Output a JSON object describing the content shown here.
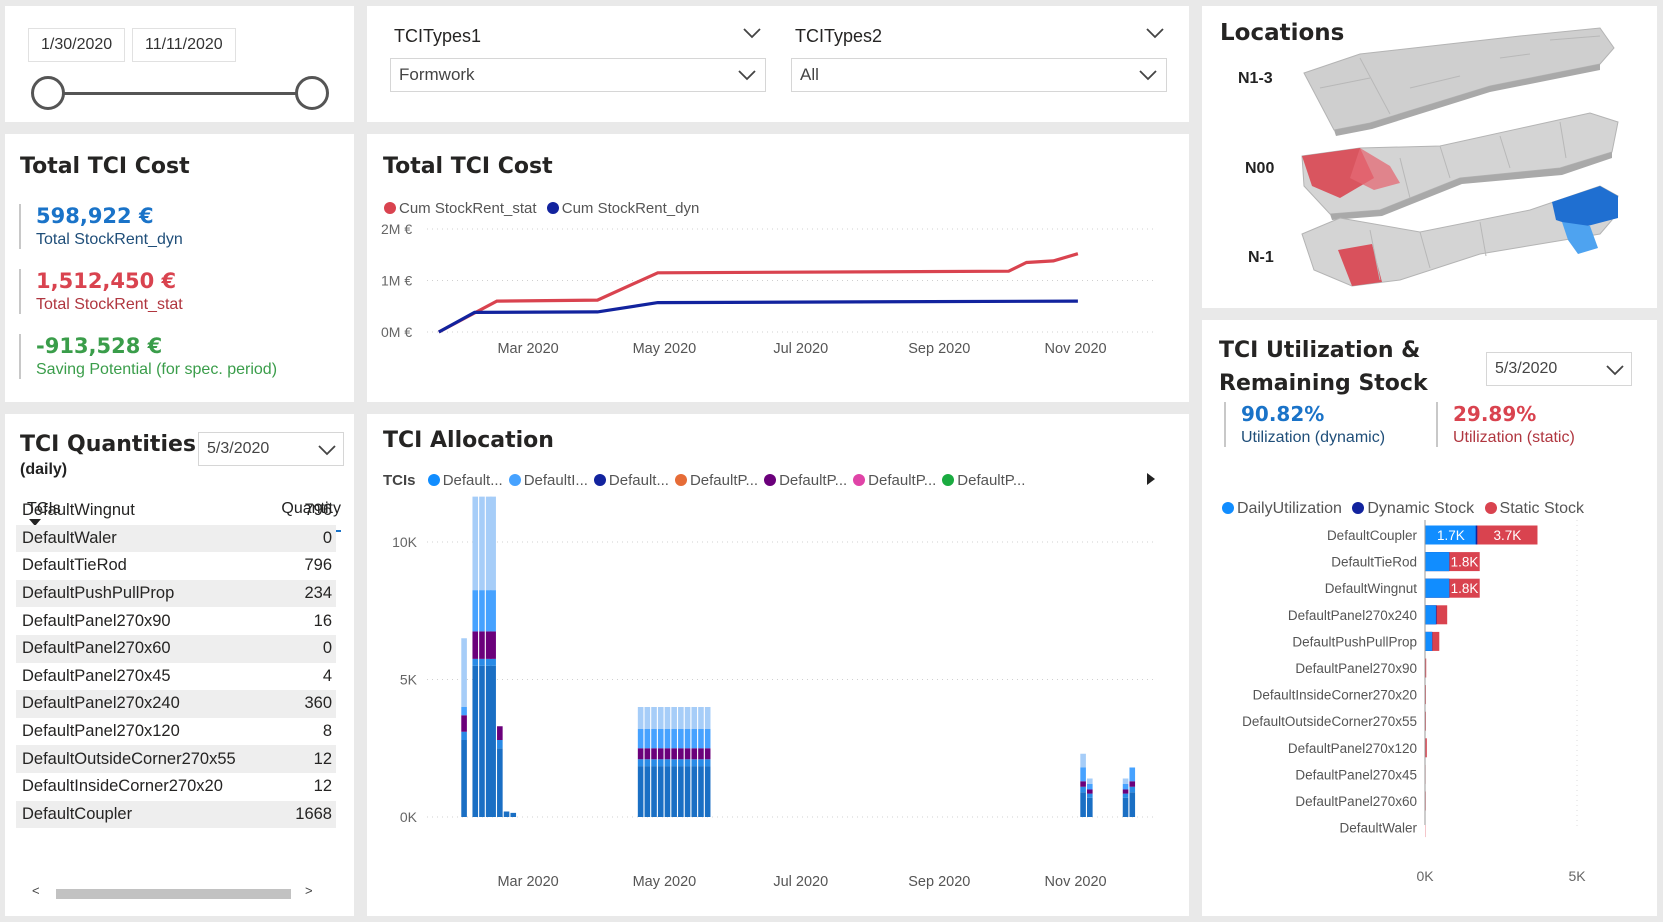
{
  "date_slicer": {
    "start": "1/30/2020",
    "end": "11/11/2020"
  },
  "filters": {
    "tcitypes1": {
      "label": "TCITypes1",
      "value": "Formwork"
    },
    "tcitypes2": {
      "label": "TCITypes2",
      "value": "All"
    }
  },
  "locations": {
    "title": "Locations",
    "levels": [
      "N1-3",
      "N00",
      "N-1"
    ]
  },
  "total_cost_kpi": {
    "title": "Total TCI Cost",
    "dyn_value": "598,922 €",
    "dyn_label": "Total StockRent_dyn",
    "stat_value": "1,512,450 €",
    "stat_label": "Total StockRent_stat",
    "saving_value": "-913,528 €",
    "saving_label": "Saving Potential (for spec. period)"
  },
  "quantities": {
    "title": "TCI Quantities",
    "subtitle": "(daily)",
    "date": "5/3/2020",
    "col_tci": "TCIs",
    "col_qty": "Quantity",
    "rows": [
      [
        "DefaultWingnut",
        "796"
      ],
      [
        "DefaultWaler",
        "0"
      ],
      [
        "DefaultTieRod",
        "796"
      ],
      [
        "DefaultPushPullProp",
        "234"
      ],
      [
        "DefaultPanel270x90",
        "16"
      ],
      [
        "DefaultPanel270x60",
        "0"
      ],
      [
        "DefaultPanel270x45",
        "4"
      ],
      [
        "DefaultPanel270x240",
        "360"
      ],
      [
        "DefaultPanel270x120",
        "8"
      ],
      [
        "DefaultOutsideCorner270x55",
        "12"
      ],
      [
        "DefaultInsideCorner270x20",
        "12"
      ],
      [
        "DefaultCoupler",
        "1668"
      ]
    ],
    "scroll_left": "<",
    "scroll_right": ">"
  },
  "utilization": {
    "title_line1": "TCI Utilization &",
    "title_line2": "Remaining Stock",
    "date": "5/3/2020",
    "dyn_value": "90.82%",
    "dyn_label": "Utilization (dynamic)",
    "stat_value": "29.89%",
    "stat_label": "Utilization (static)"
  },
  "colors": {
    "stat_red": "#d9434f",
    "dyn_navy": "#12239e",
    "dyn_blue": "#1a73c8",
    "saving_green": "#3a9d4a",
    "daily_blue": "#118dff"
  },
  "chart_data": [
    {
      "type": "line",
      "title": "Total TCI Cost",
      "series": [
        {
          "name": "Cum StockRent_stat",
          "color": "#d9434f",
          "points": [
            [
              "2020-01-30",
              0
            ],
            [
              "2020-02-25",
              0.6
            ],
            [
              "2020-04-10",
              0.62
            ],
            [
              "2020-05-07",
              1.15
            ],
            [
              "2020-10-11",
              1.18
            ],
            [
              "2020-10-19",
              1.35
            ],
            [
              "2020-10-31",
              1.38
            ],
            [
              "2020-11-11",
              1.52
            ]
          ]
        },
        {
          "name": "Cum StockRent_dyn",
          "color": "#12239e",
          "points": [
            [
              "2020-01-30",
              0
            ],
            [
              "2020-02-15",
              0.38
            ],
            [
              "2020-04-10",
              0.39
            ],
            [
              "2020-05-07",
              0.57
            ],
            [
              "2020-11-11",
              0.6
            ]
          ]
        }
      ],
      "y_ticks": [
        "2M €",
        "1M €",
        "0M €"
      ],
      "yunit": "M €",
      "ylim": [
        0,
        2
      ],
      "x_ticks": [
        "Mar 2020",
        "May 2020",
        "Jul 2020",
        "Sep 2020",
        "Nov 2020"
      ],
      "grid": true,
      "legend": "top-left"
    },
    {
      "type": "bar",
      "title": "TCI Allocation",
      "legend_title": "TCIs",
      "legend": [
        "Default...",
        "DefaultI...",
        "Default...",
        "DefaultP...",
        "DefaultP...",
        "DefaultP...",
        "DefaultP..."
      ],
      "legend_colors": [
        "#118dff",
        "#46a2ff",
        "#12239e",
        "#e66c37",
        "#6b007b",
        "#e044a7",
        "#1aab40"
      ],
      "y_ticks": [
        "10K",
        "5K",
        "0K"
      ],
      "ylim": [
        0,
        12000
      ],
      "x_ticks": [
        "Mar 2020",
        "May 2020",
        "Jul 2020",
        "Sep 2020",
        "Nov 2020"
      ],
      "grid": true,
      "stack_colors": [
        "#1a6fc4",
        "#2a8be6",
        "#6b007b",
        "#46a2ff",
        "#a6cdf8"
      ],
      "bars": [
        {
          "date": "2020-02-01",
          "stack": [
            2800,
            300,
            600,
            300,
            2500
          ]
        },
        {
          "date": "2020-02-06",
          "stack": [
            5500,
            250,
            1000,
            1500,
            3400
          ]
        },
        {
          "date": "2020-02-09",
          "stack": [
            5500,
            250,
            1000,
            1500,
            3400
          ]
        },
        {
          "date": "2020-02-12",
          "stack": [
            5500,
            250,
            1000,
            1500,
            3400
          ]
        },
        {
          "date": "2020-02-14",
          "stack": [
            5500,
            250,
            1000,
            1500,
            3400
          ]
        },
        {
          "date": "2020-02-17",
          "stack": [
            2500,
            300,
            500,
            0,
            0
          ]
        },
        {
          "date": "2020-02-20",
          "stack": [
            200,
            0,
            0,
            0,
            0
          ]
        },
        {
          "date": "2020-02-23",
          "stack": [
            150,
            0,
            0,
            0,
            0
          ]
        },
        {
          "date": "2020-04-20",
          "stack": [
            1850,
            250,
            400,
            700,
            800
          ]
        },
        {
          "date": "2020-04-23",
          "stack": [
            1850,
            250,
            400,
            700,
            800
          ]
        },
        {
          "date": "2020-04-26",
          "stack": [
            1850,
            250,
            400,
            700,
            800
          ]
        },
        {
          "date": "2020-04-29",
          "stack": [
            1850,
            250,
            400,
            700,
            800
          ]
        },
        {
          "date": "2020-05-02",
          "stack": [
            1850,
            250,
            400,
            700,
            800
          ]
        },
        {
          "date": "2020-05-05",
          "stack": [
            1850,
            250,
            400,
            700,
            800
          ]
        },
        {
          "date": "2020-05-08",
          "stack": [
            1850,
            250,
            400,
            700,
            800
          ]
        },
        {
          "date": "2020-05-11",
          "stack": [
            1850,
            250,
            400,
            700,
            800
          ]
        },
        {
          "date": "2020-05-14",
          "stack": [
            1850,
            250,
            400,
            700,
            800
          ]
        },
        {
          "date": "2020-05-17",
          "stack": [
            1850,
            250,
            400,
            700,
            800
          ]
        },
        {
          "date": "2020-05-20",
          "stack": [
            1850,
            250,
            400,
            700,
            800
          ]
        },
        {
          "date": "2020-11-04",
          "stack": [
            900,
            200,
            200,
            500,
            500
          ]
        },
        {
          "date": "2020-11-07",
          "stack": [
            700,
            150,
            150,
            200,
            200
          ]
        },
        {
          "date": "2020-11-23",
          "stack": [
            700,
            150,
            150,
            200,
            200
          ]
        },
        {
          "date": "2020-11-26",
          "stack": [
            900,
            200,
            200,
            500,
            0
          ]
        }
      ]
    },
    {
      "type": "bar",
      "orientation": "horizontal",
      "legend": [
        "DailyUtilization",
        "Dynamic Stock",
        "Static Stock"
      ],
      "colors": [
        "#118dff",
        "#12239e",
        "#d9434f"
      ],
      "xlim": [
        0,
        5500
      ],
      "x_ticks": [
        "0K",
        "5K"
      ],
      "categories": [
        "DefaultCoupler",
        "DefaultTieRod",
        "DefaultWingnut",
        "DefaultPanel270x240",
        "DefaultPushPullProp",
        "DefaultPanel270x90",
        "DefaultInsideCorner270x20",
        "DefaultOutsideCorner270x55",
        "DefaultPanel270x120",
        "DefaultPanel270x45",
        "DefaultPanel270x60",
        "DefaultWaler"
      ],
      "daily": [
        1668,
        796,
        796,
        360,
        234,
        16,
        12,
        12,
        8,
        4,
        0,
        0
      ],
      "dynamic": [
        1720,
        800,
        800,
        380,
        240,
        16,
        12,
        12,
        8,
        4,
        0,
        0
      ],
      "static": [
        3700,
        1800,
        1800,
        730,
        470,
        40,
        30,
        30,
        60,
        20,
        25,
        10
      ],
      "labels_daily": [
        "1.7K",
        "",
        "",
        "",
        "",
        "",
        "",
        "",
        "",
        "",
        "",
        ""
      ],
      "labels_static": [
        "3.7K",
        "1.8K",
        "1.8K",
        "",
        "",
        "",
        "",
        "",
        "",
        "",
        "",
        ""
      ]
    }
  ]
}
